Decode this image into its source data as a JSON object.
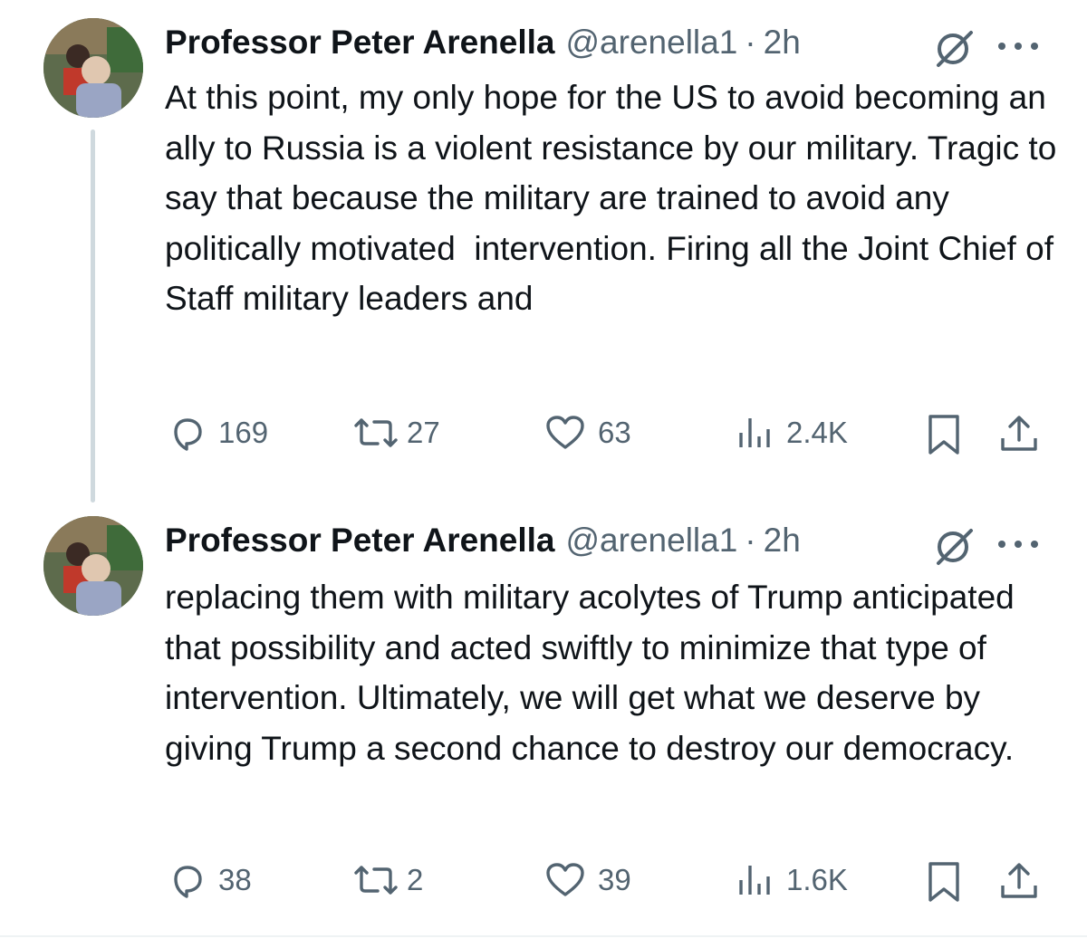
{
  "tweets": [
    {
      "author_name": "Professor Peter Arenella",
      "handle": "@arenella1",
      "separator": "·",
      "time": "2h",
      "text": "At this point, my only hope for the US to avoid becoming an ally to Russia is a violent resistance by our military. Tragic to say that because the military are trained to avoid any politically motivated  intervention. Firing all the Joint Chief of Staff military leaders and",
      "replies": "169",
      "reposts": "27",
      "likes": "63",
      "views": "2.4K"
    },
    {
      "author_name": "Professor Peter Arenella",
      "handle": "@arenella1",
      "separator": "·",
      "time": "2h",
      "text": "replacing them with military acolytes of Trump anticipated that possibility and acted swiftly to minimize that type of intervention. Ultimately, we will get what we deserve by giving Trump a second chance to destroy our democracy.",
      "replies": "38",
      "reposts": "2",
      "likes": "39",
      "views": "1.6K"
    }
  ],
  "icons": {
    "reply": "reply-icon",
    "repost": "repost-icon",
    "like": "heart-icon",
    "views": "views-icon",
    "bookmark": "bookmark-icon",
    "share": "share-icon",
    "grok": "grok-icon",
    "more": "more-icon"
  },
  "colors": {
    "text": "#0f1419",
    "secondary": "#536471",
    "thread_line": "#cfd9de"
  }
}
